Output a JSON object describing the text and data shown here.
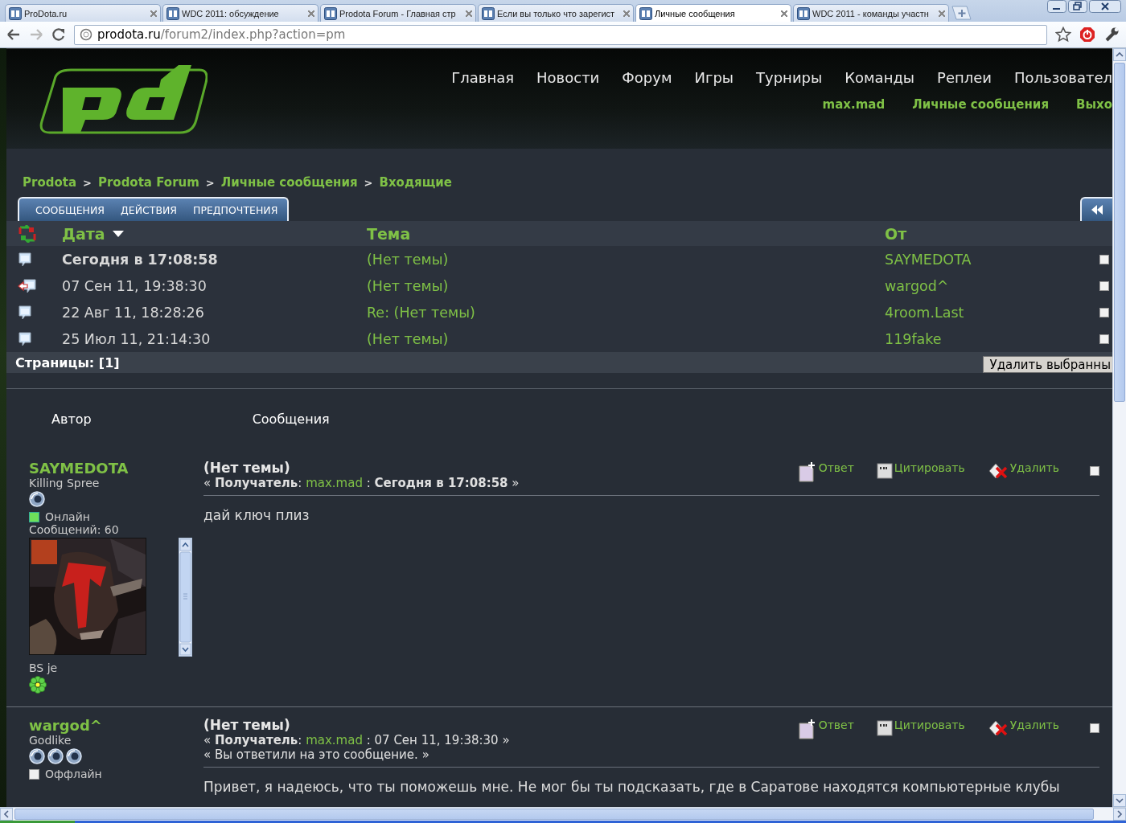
{
  "browser": {
    "tabs": [
      {
        "title": "ProDota.ru",
        "selected": false
      },
      {
        "title": "WDC 2011: обсуждение",
        "selected": false
      },
      {
        "title": "Prodota Forum - Главная стр",
        "selected": false
      },
      {
        "title": "Если вы только что зарегист",
        "selected": false
      },
      {
        "title": "Личные сообщения",
        "selected": true
      },
      {
        "title": "WDC 2011 - команды участн",
        "selected": false
      }
    ],
    "url": {
      "host": "prodota.ru",
      "path": "/forum2/index.php?action=pm"
    }
  },
  "header": {
    "nav": [
      "Главная",
      "Новости",
      "Форум",
      "Игры",
      "Турниры",
      "Команды",
      "Реплеи",
      "Пользовател"
    ],
    "user_links": [
      "max.mad",
      "Личные сообщения",
      "Выхо"
    ]
  },
  "breadcrumb": {
    "separator": ">",
    "items": [
      "Prodota",
      "Prodota Forum",
      "Личные сообщения",
      "Входящие"
    ]
  },
  "menu_tabs": [
    "СООБЩЕНИЯ",
    "ДЕЙСТВИЯ",
    "ПРЕДПОЧТЕНИЯ"
  ],
  "table": {
    "columns": [
      {
        "label": "Дата",
        "sorted": true
      },
      {
        "label": "Тема",
        "sorted": false
      },
      {
        "label": "От",
        "sorted": false
      }
    ],
    "rows": [
      {
        "kind": "read",
        "date": "Сегодня в 17:08:58",
        "subject": "(Нет темы)",
        "from": "SAYMEDOTA",
        "unread": true,
        "checked": false
      },
      {
        "kind": "replied",
        "date": "07 Сен 11, 19:38:30",
        "subject": "(Нет темы)",
        "from": "wargod^",
        "unread": false,
        "checked": false
      },
      {
        "kind": "read",
        "date": "22 Авг 11, 18:28:26",
        "subject": "Re: (Нет темы)",
        "from": "4room.Last",
        "unread": false,
        "checked": false
      },
      {
        "kind": "read",
        "date": "25 Июл 11, 21:14:30",
        "subject": "(Нет темы)",
        "from": "119fake",
        "unread": false,
        "checked": false
      }
    ]
  },
  "pages": "Страницы: [1]",
  "delete_selected_button": "Удалить выбранны",
  "posts_header": {
    "author": "Автор",
    "messages": "Сообщения"
  },
  "posts": [
    {
      "author": "SAYMEDOTA",
      "rank": "Killing Spree",
      "rank_icons": [
        {
          "kind": "orb"
        }
      ],
      "online": true,
      "status": "Онлайн",
      "post_count": "Сообщений: 60",
      "avatar": {
        "kind": "picture"
      },
      "signature": "BS je",
      "icq": true,
      "title": "(Нет темы)",
      "meta_before": "« **Получатель**: ",
      "recipient": "max.mad",
      "meta_after": " : **Сегодня в 17:08:58** »",
      "actions": [
        {
          "kind": "reply",
          "label": "Ответ"
        },
        {
          "kind": "quote",
          "label": "Цитировать"
        },
        {
          "kind": "delete",
          "label": "Удалить"
        }
      ],
      "checked": false,
      "body": "дай ключ плиз"
    },
    {
      "author": "wargod^",
      "rank": "Godlike",
      "rank_icons": [
        {
          "kind": "orb"
        },
        {
          "kind": "orb"
        },
        {
          "kind": "orb"
        }
      ],
      "online": false,
      "status": "Оффлайн",
      "title": "(Нет темы)",
      "meta_before": "« **Получатель**: ",
      "recipient": "max.mad",
      "meta_after": " : 07 Сен 11, 19:38:30 »",
      "note": "« Вы ответили на это сообщение. »",
      "actions": [
        {
          "kind": "reply",
          "label": "Ответ"
        },
        {
          "kind": "quote",
          "label": "Цитировать"
        },
        {
          "kind": "delete",
          "label": "Удалить"
        }
      ],
      "checked": false,
      "body": "Привет, я надеюсь, что ты поможешь мне. Не мог бы ты подсказать, где в Саратове находятся компьютерные клубы"
    }
  ]
}
